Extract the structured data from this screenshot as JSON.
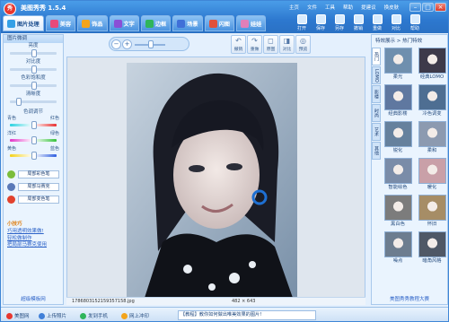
{
  "app": {
    "title": "美图秀秀 1.5.4",
    "logo": "秀"
  },
  "menu": [
    "主页",
    "文件",
    "工具",
    "帮助",
    "提建议",
    "换皮肤"
  ],
  "window_controls": [
    "–",
    "□",
    "×"
  ],
  "tabs": [
    {
      "label": "图片处理",
      "icon_color": "#35a0e6",
      "active": true
    },
    {
      "label": "美容",
      "icon_color": "#e84a7a"
    },
    {
      "label": "饰品",
      "icon_color": "#f3a41b"
    },
    {
      "label": "文字",
      "icon_color": "#8a4fd6"
    },
    {
      "label": "边框",
      "icon_color": "#2fb55b"
    },
    {
      "label": "场景",
      "icon_color": "#3f6fd8"
    },
    {
      "label": "闪图",
      "icon_color": "#e0513c"
    },
    {
      "label": "娃娃",
      "icon_color": "#e07fb9"
    }
  ],
  "toolbar": [
    "打开",
    "保存",
    "另存",
    "撤销",
    "重做",
    "对比",
    "帮助"
  ],
  "edit_buttons": [
    {
      "label": "撤销",
      "icon": "↶"
    },
    {
      "label": "重做",
      "icon": "↷"
    },
    {
      "label": "原图",
      "icon": "◻"
    },
    {
      "label": "对比",
      "icon": "◨"
    },
    {
      "label": "预览",
      "icon": "◎"
    }
  ],
  "zoom": {
    "minus": "−",
    "plus": "+"
  },
  "left_panel": {
    "title": "图片微调",
    "sliders": [
      {
        "label": "亮度",
        "value": 0.5,
        "track": "#c6d9ee"
      },
      {
        "label": "对比度",
        "value": 0.5,
        "track": "#c6d9ee"
      },
      {
        "label": "色彩饱和度",
        "value": 0.5,
        "track": "#c6d9ee"
      },
      {
        "label": "清晰度",
        "value": 0.15,
        "track": "#c6d9ee"
      }
    ],
    "color_title": "色调调节",
    "color_sliders": [
      {
        "left": "青色",
        "right": "红色",
        "track": "linear-gradient(90deg,#2bd2e0,#ffffff,#e83232)",
        "value": 0.5
      },
      {
        "left": "洋红",
        "right": "绿色",
        "track": "linear-gradient(90deg,#e234c7,#ffffff,#35c23a)",
        "value": 0.5
      },
      {
        "left": "黄色",
        "right": "蓝色",
        "track": "linear-gradient(90deg,#f4d21a,#ffffff,#2f5fe0)",
        "value": 0.5
      }
    ],
    "effects": [
      {
        "label": "局部彩色笔",
        "color": "#7bbd3a"
      },
      {
        "label": "局部马赛克",
        "color": "#5a79b8"
      },
      {
        "label": "局部变色笔",
        "color": "#e2422d"
      }
    ],
    "tips_title": "小技巧",
    "tips": [
      "巧用透明效果做!",
      "轻松做制作",
      "把局部马赛克使用"
    ],
    "footer": "超级模板网"
  },
  "image_info": {
    "filename": "1786803152159357158.jpg",
    "size": "482 × 643"
  },
  "right_panel": {
    "header": "特效展示 > 热门特效",
    "vtabs": [
      "热门",
      "LOMO",
      "影楼",
      "时尚",
      "艺术",
      "其他"
    ],
    "effects": [
      {
        "label": "柔光",
        "tint": "#6f8fae"
      },
      {
        "label": "经典LOMO",
        "tint": "#3d3a4a"
      },
      {
        "label": "经典影楼",
        "tint": "#5f78a0"
      },
      {
        "label": "冷色调变",
        "tint": "#4e6e92"
      },
      {
        "label": "锐化",
        "tint": "#66819d"
      },
      {
        "label": "柔和",
        "tint": "#8c9ab0"
      },
      {
        "label": "智能绘色",
        "tint": "#7a8ca8"
      },
      {
        "label": "暖化",
        "tint": "#c9a0a8"
      },
      {
        "label": "黑白色",
        "tint": "#7c7c7c"
      },
      {
        "label": "怀旧",
        "tint": "#a68d66"
      },
      {
        "label": "噪点",
        "tint": "#6d7d8f"
      },
      {
        "label": "暗角风格",
        "tint": "#4f5866"
      }
    ],
    "footer": "美图秀秀教程大赛"
  },
  "statusbar": {
    "items": [
      {
        "label": "美图网",
        "color": "#e8372f"
      },
      {
        "label": "上传照片",
        "color": "#3f7fd8"
      },
      {
        "label": "发到手机",
        "color": "#2fb55b"
      },
      {
        "label": "网上冲印",
        "color": "#f3a41b"
      }
    ],
    "news": "【教程】教你如何做出唯美效果的图片!"
  }
}
